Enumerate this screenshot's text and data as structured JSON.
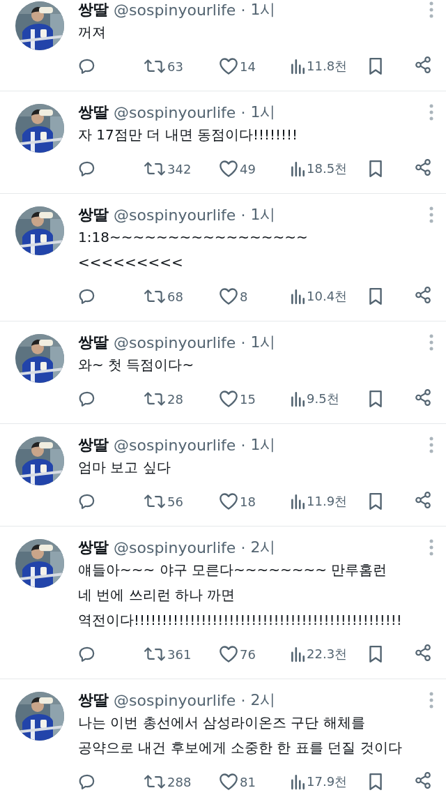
{
  "tweets": [
    {
      "name": "쌍딸",
      "handle": "@sospinyourlife",
      "separator": "·",
      "time": "1시",
      "text": "꺼져",
      "retweets": "63",
      "likes": "14",
      "views": "11.8천"
    },
    {
      "name": "쌍딸",
      "handle": "@sospinyourlife",
      "separator": "·",
      "time": "1시",
      "text": "자 17점만 더 내면 동점이다!!!!!!!!",
      "retweets": "342",
      "likes": "49",
      "views": "18.5천"
    },
    {
      "name": "쌍딸",
      "handle": "@sospinyourlife",
      "separator": "·",
      "time": "1시",
      "text": "1:18~~~~~~~~~~~~~~~~~<<<<<<<<<",
      "retweets": "68",
      "likes": "8",
      "views": "10.4천"
    },
    {
      "name": "쌍딸",
      "handle": "@sospinyourlife",
      "separator": "·",
      "time": "1시",
      "text": "와~ 첫 득점이다~",
      "retweets": "28",
      "likes": "15",
      "views": "9.5천"
    },
    {
      "name": "쌍딸",
      "handle": "@sospinyourlife",
      "separator": "·",
      "time": "1시",
      "text": "엄마 보고 싶다",
      "retweets": "56",
      "likes": "18",
      "views": "11.9천"
    },
    {
      "name": "쌍딸",
      "handle": "@sospinyourlife",
      "separator": "·",
      "time": "2시",
      "text": "얘들아~~~ 야구 모른다~~~~~~~~ 만루홈런 네 번에 쓰리런 하나 까면 역전이다!!!!!!!!!!!!!!!!!!!!!!!!!!!!!!!!!!!!!!!!!!!!!!!!",
      "retweets": "361",
      "likes": "76",
      "views": "22.3천"
    },
    {
      "name": "쌍딸",
      "handle": "@sospinyourlife",
      "separator": "·",
      "time": "2시",
      "text": "나는 이번 총선에서 삼성라이온즈 구단 해체를 공약으로 내건 후보에게 소중한 한 표를 던질 것이다",
      "retweets": "288",
      "likes": "81",
      "views": "17.9천"
    }
  ]
}
